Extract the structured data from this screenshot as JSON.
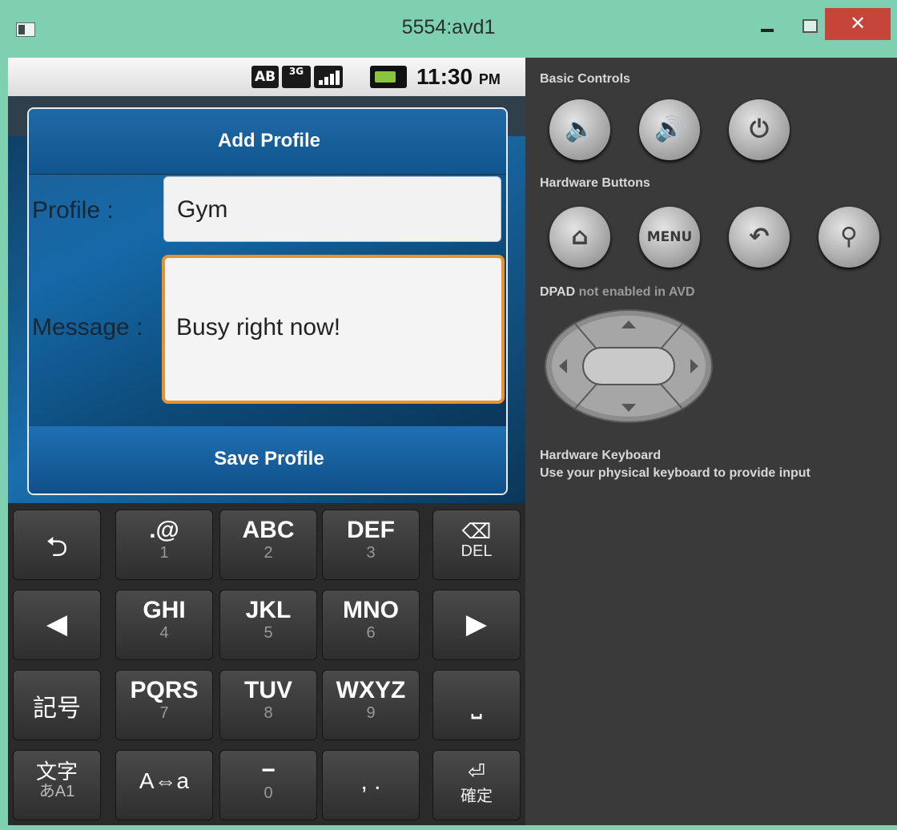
{
  "window": {
    "title": "5554:avd1",
    "close_glyph": "✕"
  },
  "statusbar": {
    "ab_icon": "AB",
    "network_icon": "3G",
    "time": "11:30",
    "ampm": "PM"
  },
  "dialog": {
    "title": "Add Profile",
    "profile_label": "Profile :",
    "profile_value": "Gym",
    "message_label": "Message :",
    "message_value": "Busy right now!",
    "save_label": "Save Profile"
  },
  "keyboard": {
    "keys": [
      {
        "main": "⮌",
        "sub": ""
      },
      {
        "main": ".@",
        "sub": "1"
      },
      {
        "main": "ABC",
        "sub": "2"
      },
      {
        "main": "DEF",
        "sub": "3"
      },
      {
        "main": "⌫",
        "sub": "DEL"
      },
      {
        "main": "◀",
        "sub": ""
      },
      {
        "main": "GHI",
        "sub": "4"
      },
      {
        "main": "JKL",
        "sub": "5"
      },
      {
        "main": "MNO",
        "sub": "6"
      },
      {
        "main": "▶",
        "sub": ""
      },
      {
        "main": "記号",
        "sub": ""
      },
      {
        "main": "PQRS",
        "sub": "7"
      },
      {
        "main": "TUV",
        "sub": "8"
      },
      {
        "main": "WXYZ",
        "sub": "9"
      },
      {
        "main": "⎵",
        "sub": ""
      },
      {
        "main": "文字",
        "sub": "あA1"
      },
      {
        "main": "A⇔a",
        "sub": ""
      },
      {
        "main": "−",
        "sub": "0"
      },
      {
        "main": ", .",
        "sub": ""
      },
      {
        "main": "⏎",
        "sub": "確定"
      }
    ]
  },
  "controls": {
    "basic_title": "Basic Controls",
    "hardware_title": "Hardware Buttons",
    "menu_label": "MENU",
    "dpad_title_bold": "DPAD",
    "dpad_title_rest": "not enabled in AVD",
    "keyboard_title": "Hardware Keyboard",
    "keyboard_desc": "Use your physical keyboard to provide input"
  },
  "colors": {
    "titlebar": "#7fcfb1",
    "dialog_blue": "#1569a8",
    "focus_orange": "#e7922f",
    "close_red": "#c7443a",
    "panel_gray": "#3a3a3a"
  }
}
